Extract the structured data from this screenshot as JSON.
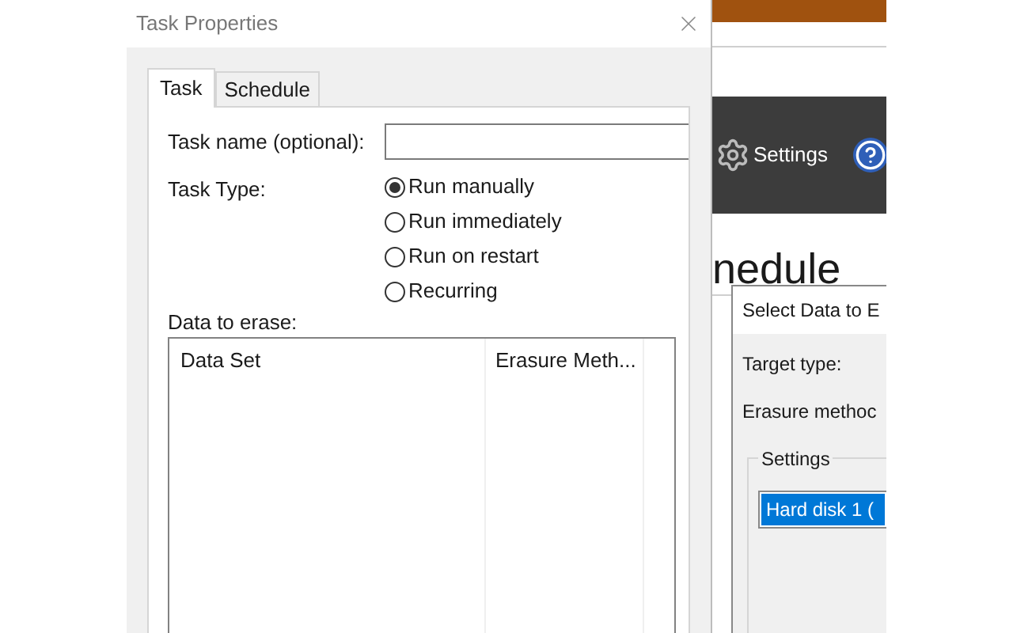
{
  "task_dialog": {
    "title": "Task Properties",
    "tabs": [
      {
        "label": "Task",
        "selected": true
      },
      {
        "label": "Schedule",
        "selected": false
      }
    ],
    "task_name": {
      "label": "Task name (optional):"
    },
    "task_type": {
      "label": "Task Type:",
      "options": [
        {
          "label": "Run manually",
          "selected": true
        },
        {
          "label": "Run immediately",
          "selected": false
        },
        {
          "label": "Run on restart",
          "selected": false
        },
        {
          "label": "Recurring",
          "selected": false
        }
      ]
    },
    "data_list": {
      "label": "Data to erase:",
      "columns": [
        "Data Set",
        "Erasure Meth..."
      ]
    }
  },
  "background_app": {
    "toolbar": {
      "items": [
        {
          "label": "Settings"
        }
      ]
    },
    "heading": "nedule",
    "select_dialog": {
      "title": "Select Data to E",
      "fields": [
        "Target type:",
        "Erasure methoc"
      ],
      "group": {
        "title": "Settings",
        "items": [
          {
            "label": "Hard disk 1 (",
            "selected": true
          }
        ]
      }
    }
  }
}
